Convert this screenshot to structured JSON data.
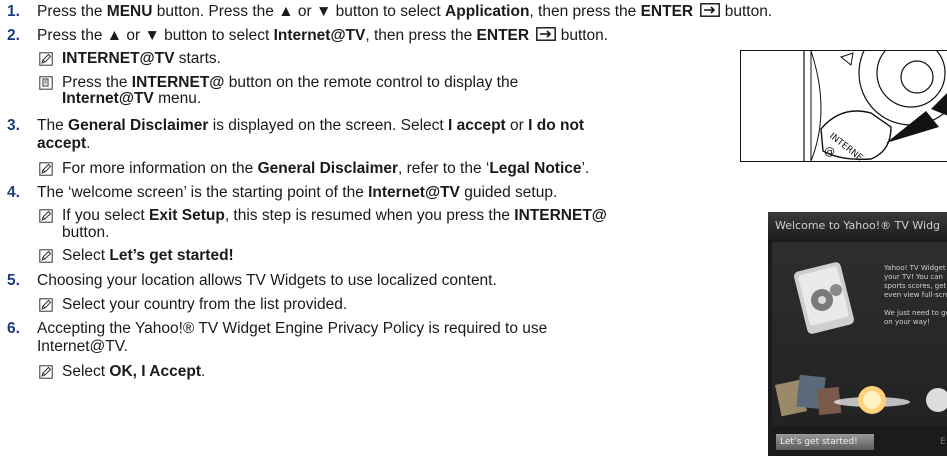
{
  "steps": [
    {
      "number": "1.",
      "main": {
        "a": "Press the ",
        "b": "MENU",
        "c": " button. Press the ▲ or ▼ button to select ",
        "d": "Application",
        "e": ", then press the ",
        "f": "ENTER",
        "g": " button."
      }
    },
    {
      "number": "2.",
      "main": {
        "a": "Press the ▲ or ▼ button to select ",
        "b": "Internet@TV",
        "c": ", then press the ",
        "d": "ENTER",
        "e": " button."
      },
      "note1": "INTERNET@TV",
      "note1_suffix": " starts.",
      "tip": {
        "a": "Press the ",
        "b": "INTERNET@",
        "c": " button on the remote control to display the",
        "d": "Internet@TV",
        "e": " menu."
      }
    },
    {
      "number": "3.",
      "main": {
        "a": "The ",
        "b": "General Disclaimer",
        "c": " is displayed on the screen. Select ",
        "d": "I accept",
        "e": " or ",
        "f": "I do not",
        "g": "accept",
        "h": "."
      },
      "note": {
        "a": "For more information on the ",
        "b": "General Disclaimer",
        "c": ", refer to the ‘",
        "d": "Legal Notice",
        "e": "’."
      }
    },
    {
      "number": "4.",
      "main": {
        "a": "The ‘welcome screen’ is the starting point of the ",
        "b": "Internet@TV",
        "c": " guided setup."
      },
      "note1": {
        "a": "If you select ",
        "b": "Exit Setup",
        "c": ", this step is resumed when you press the ",
        "d": "INTERNET@",
        "e": "button."
      },
      "note2": {
        "a": "Select ",
        "b": "Let’s get started!"
      }
    },
    {
      "number": "5.",
      "main": "Choosing your location allows TV Widgets to use localized content.",
      "note": "Select your country from the list provided."
    },
    {
      "number": "6.",
      "main": {
        "a": "Accepting the Yahoo!® TV Widget Engine Privacy Policy is required to use",
        "b": "Internet@TV."
      },
      "note": {
        "a": "Select ",
        "b": "OK, I Accept",
        "c": "."
      }
    }
  ],
  "remote": {
    "label_1": "INTERNE",
    "label_2": "@"
  },
  "tv": {
    "title": "Welcome to Yahoo!® TV Widg",
    "text_lines": [
      "Yahoo! TV Widget",
      "your TV! You can",
      "sports scores, get",
      "even view full-scre"
    ],
    "text_lines_2": [
      "We just need to ge",
      "on your way!"
    ],
    "button": "Let’s get started!",
    "button_right": "E"
  },
  "colors": {
    "number": "#1a3d7a",
    "text": "#1a1a1a"
  }
}
